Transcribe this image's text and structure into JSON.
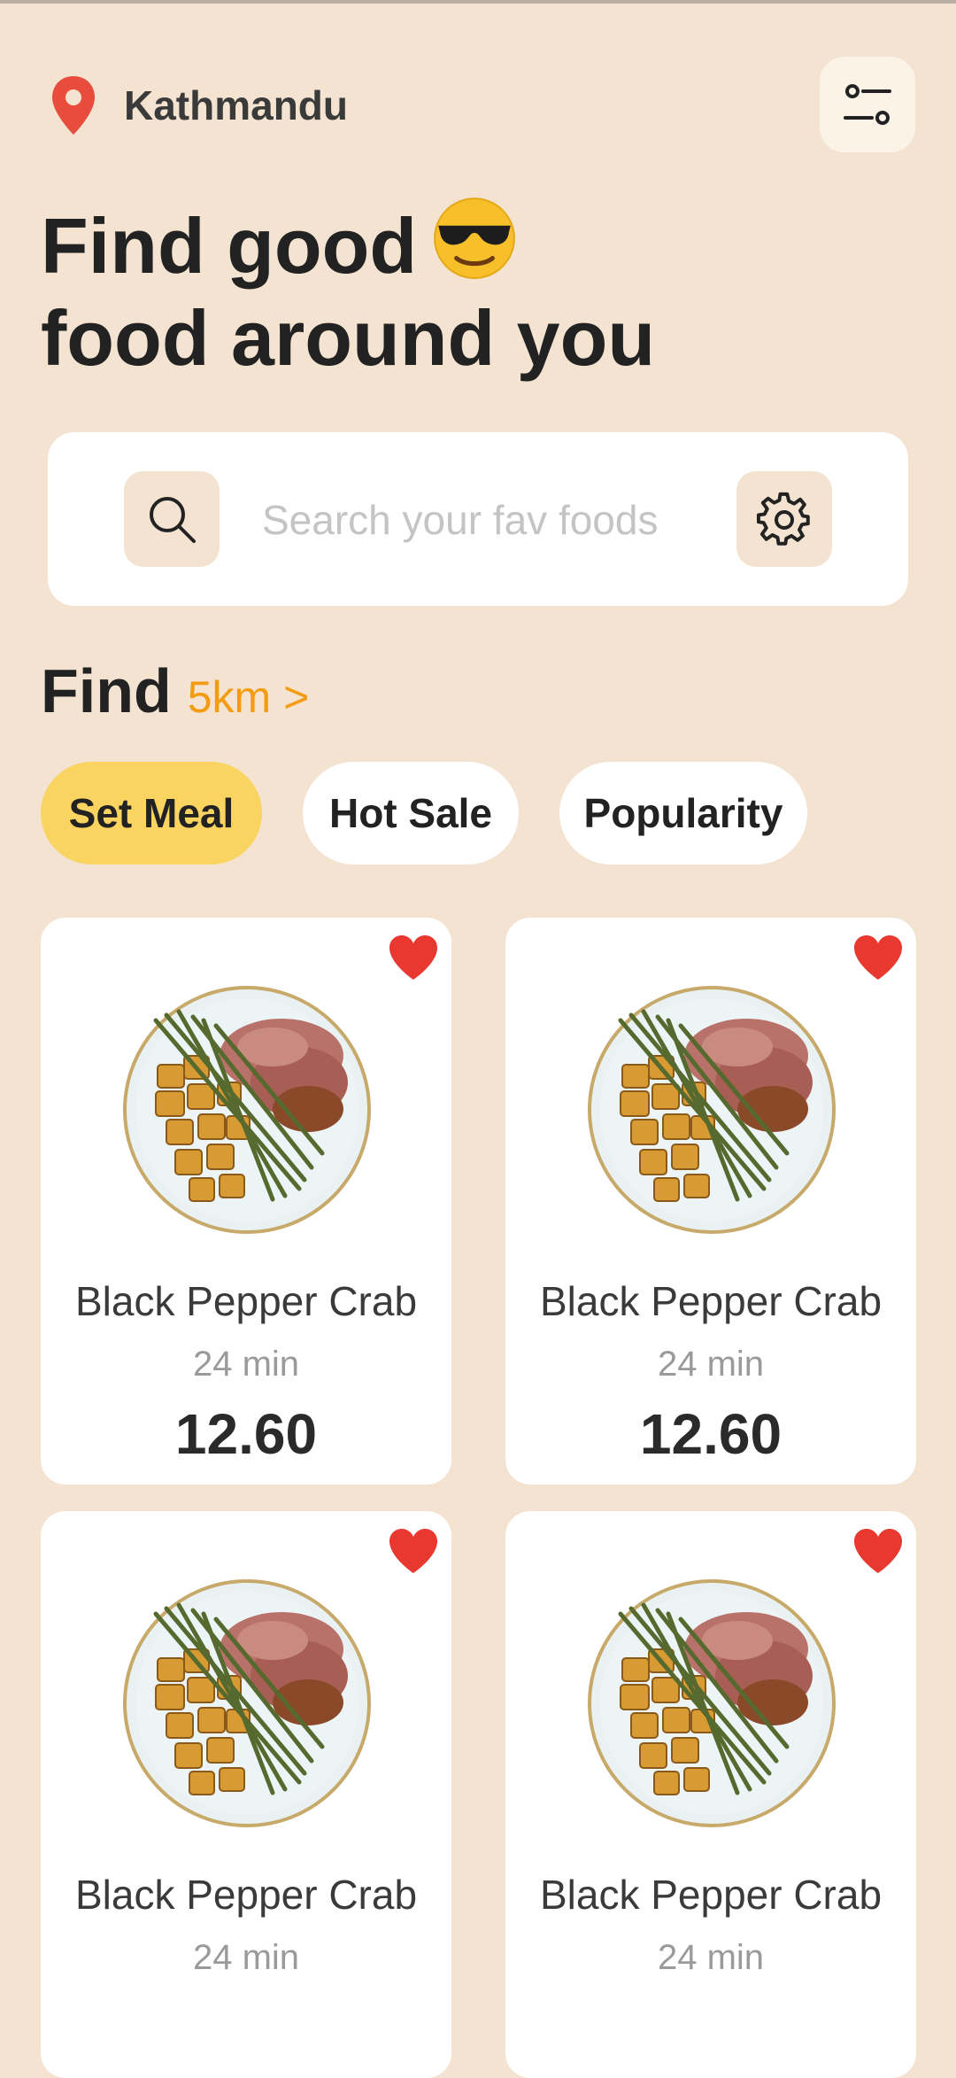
{
  "header": {
    "location": "Kathmandu",
    "filter_icon": "sliders-icon",
    "pin_icon": "location-pin-icon"
  },
  "headline": {
    "line1": "Find good",
    "emoji": "smiling-face-with-sunglasses",
    "line2": "food around you"
  },
  "search": {
    "placeholder": "Search your fav foods",
    "value": "",
    "search_icon": "search-icon",
    "settings_icon": "gear-icon"
  },
  "find": {
    "title": "Find",
    "distance": "5km >"
  },
  "chips": [
    {
      "label": "Set Meal",
      "active": true
    },
    {
      "label": "Hot Sale",
      "active": false
    },
    {
      "label": "Popularity",
      "active": false
    }
  ],
  "cards": [
    {
      "name": "Black Pepper Crab",
      "time": "24 min",
      "price": "12.60",
      "favorite": true
    },
    {
      "name": "Black Pepper Crab",
      "time": "24 min",
      "price": "12.60",
      "favorite": true
    },
    {
      "name": "Black Pepper Crab",
      "time": "24 min",
      "price": "",
      "favorite": true
    },
    {
      "name": "Black Pepper Crab",
      "time": "24 min",
      "price": "",
      "favorite": true
    }
  ],
  "colors": {
    "background": "#f3e3d0",
    "accent_chip": "#f9d461",
    "distance": "#f39c12",
    "heart": "#e8382f",
    "pin": "#e74c3c"
  }
}
